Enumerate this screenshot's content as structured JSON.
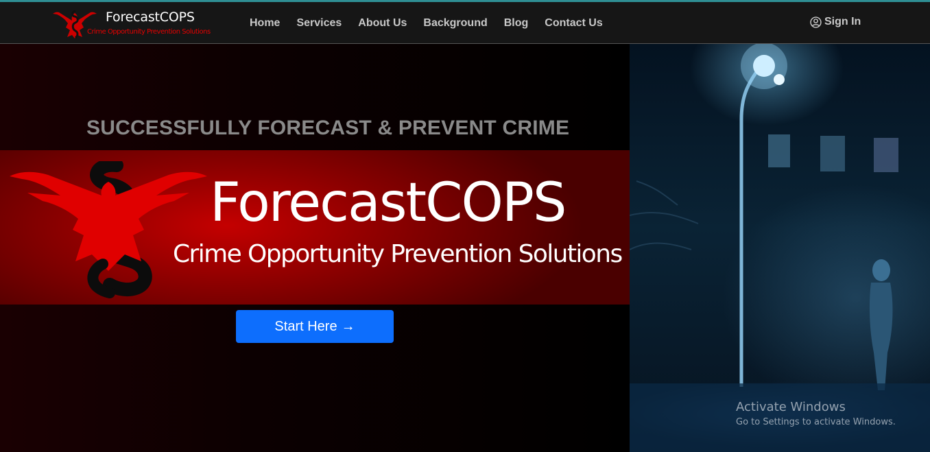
{
  "brand": {
    "name": "ForecastCOPS",
    "tagline": "Crime Opportunity Prevention Solutions",
    "accent_color": "#e60000"
  },
  "nav": {
    "links": [
      {
        "label": "Home"
      },
      {
        "label": "Services"
      },
      {
        "label": "About Us"
      },
      {
        "label": "Background"
      },
      {
        "label": "Blog"
      },
      {
        "label": "Contact Us"
      }
    ],
    "signin": {
      "label": "Sign In",
      "icon": "user-circle-icon"
    }
  },
  "hero": {
    "headline": "SUCCESSFULLY FORECAST & PREVENT CRIME",
    "banner_title": "ForecastCOPS",
    "banner_subtitle": "Crime Opportunity Prevention Solutions",
    "cta": {
      "label": "Start Here",
      "icon": "arrow-right-icon",
      "color": "#0d6efd"
    }
  },
  "watermark": {
    "title": "Activate Windows",
    "subtitle": "Go to Settings to activate Windows."
  }
}
